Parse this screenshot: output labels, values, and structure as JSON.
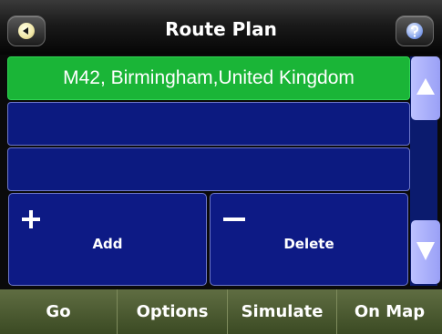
{
  "header": {
    "title": "Route Plan",
    "back_icon": "back-arrow-icon",
    "help_icon": "help-icon"
  },
  "route_list": {
    "items": [
      {
        "label": "M42, Birmingham,United Kingdom",
        "selected": true
      },
      {
        "label": "",
        "selected": false
      },
      {
        "label": "",
        "selected": false
      }
    ]
  },
  "actions": {
    "add_label": "Add",
    "delete_label": "Delete"
  },
  "scroll": {
    "up_icon": "triangle-up-icon",
    "down_icon": "triangle-down-icon"
  },
  "bottom_bar": {
    "go_label": "Go",
    "options_label": "Options",
    "simulate_label": "Simulate",
    "on_map_label": "On Map"
  },
  "colors": {
    "selected_row": "#1ab537",
    "row": "#0c1a80",
    "bottom_bar": "#4c5a31"
  }
}
